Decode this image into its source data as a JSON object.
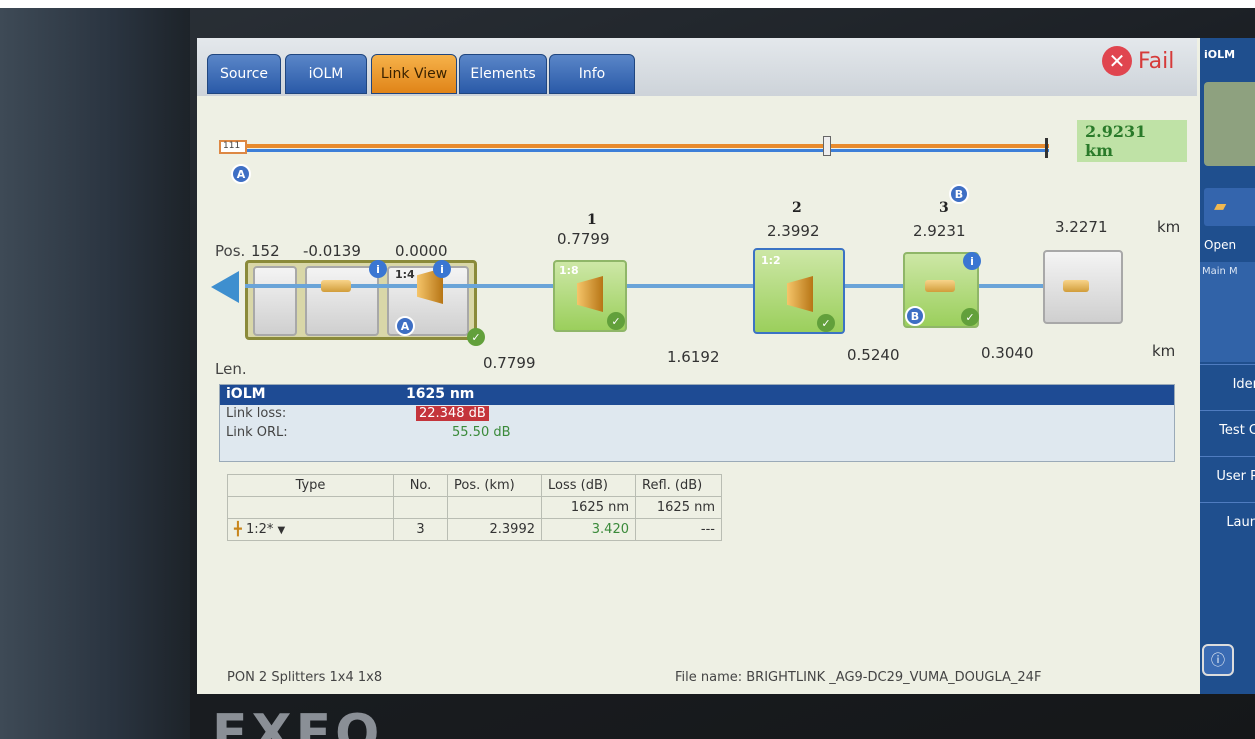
{
  "tabs": [
    {
      "label": "Source",
      "active": false
    },
    {
      "label": "iOLM",
      "active": false
    },
    {
      "label": "Link View",
      "active": true
    },
    {
      "label": "Elements",
      "active": false
    },
    {
      "label": "Info",
      "active": false
    }
  ],
  "status": {
    "icon": "fail-icon",
    "label": "Fail",
    "color": "#d63a3a"
  },
  "overview": {
    "total_length": "2.9231 km",
    "start_marker": "A",
    "end_marker": "B",
    "start_glyph": "111"
  },
  "link_view": {
    "pos_label": "Pos.",
    "len_label": "Len.",
    "unit": "km",
    "positions": [
      "152",
      "-0.0139",
      "0.0000",
      "0.7799",
      "2.3992",
      "2.9231",
      "3.2271"
    ],
    "event_numbers": [
      "1",
      "2",
      "3"
    ],
    "lengths": [
      "0.7799",
      "1.6192",
      "0.5240",
      "0.3040"
    ],
    "splitter_ratios": [
      "1:4",
      "1:8",
      "1:2"
    ],
    "marker_a": "A",
    "marker_b": "B"
  },
  "summary": {
    "title": "iOLM",
    "wavelength": "1625 nm",
    "link_loss_label": "Link loss:",
    "link_loss_value": "22.348 dB",
    "link_orl_label": "Link ORL:",
    "link_orl_value": "55.50 dB"
  },
  "table": {
    "headers": [
      "Type",
      "No.",
      "Pos. (km)",
      "Loss (dB)",
      "Refl. (dB)"
    ],
    "subheaders": [
      "",
      "",
      "",
      "1625 nm",
      "1625 nm"
    ],
    "row": {
      "type": "1:2*",
      "no": "3",
      "pos": "2.3992",
      "loss": "3.420",
      "refl": "---"
    }
  },
  "status_bar": {
    "test_name": "PON 2 Splitters 1x4 1x8",
    "file_name": "File name: BRIGHTLINK _AG9-DC29_VUMA_DOUGLA_24F"
  },
  "right_panel": {
    "title": "iOLM",
    "open_label": "Open",
    "main_menu_label": "Main M",
    "items": [
      "Ider",
      "Test C",
      "User P",
      "Laun"
    ]
  },
  "device_brand": "EXFO"
}
